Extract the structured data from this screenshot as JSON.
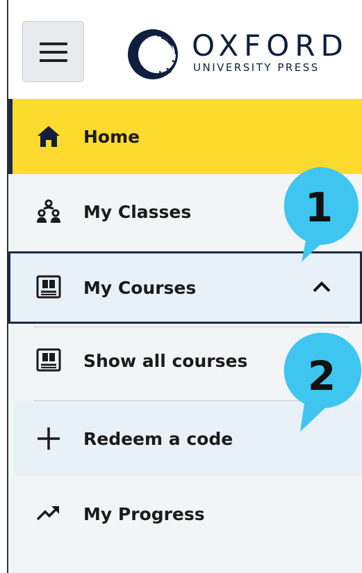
{
  "header": {
    "menu_icon": "hamburger-menu-icon",
    "logo": {
      "name": "OXFORD",
      "subtitle": "UNIVERSITY PRESS"
    }
  },
  "nav": {
    "items": [
      {
        "label": "Home",
        "icon": "home-icon",
        "active": true
      },
      {
        "label": "My Classes",
        "icon": "classes-icon"
      },
      {
        "label": "My Courses",
        "icon": "book-icon",
        "expanded": true
      },
      {
        "label": "Show all courses",
        "icon": "book-icon"
      },
      {
        "label": "Redeem a code",
        "icon": "plus-icon"
      },
      {
        "label": "My Progress",
        "icon": "trend-up-icon"
      }
    ]
  },
  "callouts": [
    {
      "number": "1"
    },
    {
      "number": "2"
    }
  ],
  "colors": {
    "active_bg": "#fddb2e",
    "nav_bg": "#f2f4f5",
    "highlight_bg": "#e8f1f8",
    "callout": "#3ec6f0",
    "border_dark": "#1b2a4a"
  }
}
